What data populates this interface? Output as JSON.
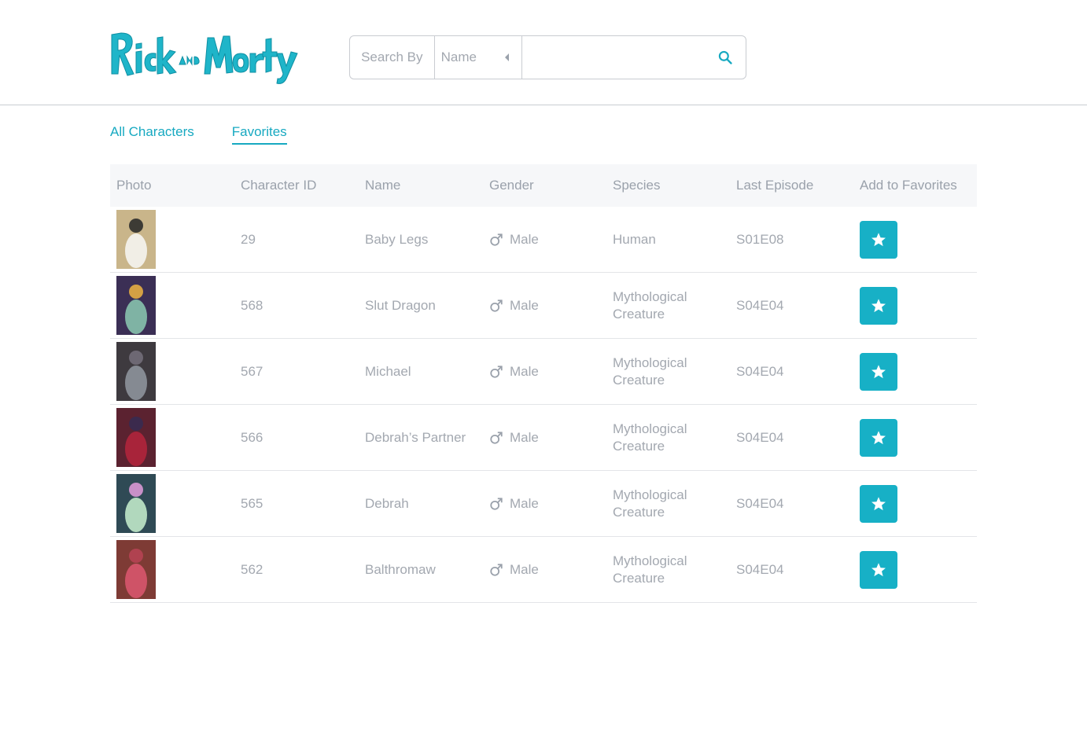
{
  "header": {
    "logo_text": "Rick and Morty",
    "search": {
      "by_label": "Search By",
      "select_value": "Name",
      "input_value": "",
      "input_placeholder": ""
    }
  },
  "tabs": [
    {
      "label": "All Characters",
      "active": false
    },
    {
      "label": "Favorites",
      "active": true
    }
  ],
  "table": {
    "columns": [
      "Photo",
      "Character ID",
      "Name",
      "Gender",
      "Species",
      "Last Episode",
      "Add to Favorites"
    ],
    "rows": [
      {
        "id": "29",
        "name": "Baby Legs",
        "gender": "Male",
        "species": "Human",
        "last_episode": "S01E08"
      },
      {
        "id": "568",
        "name": "Slut Dragon",
        "gender": "Male",
        "species": "Mythological Creature",
        "last_episode": "S04E04"
      },
      {
        "id": "567",
        "name": "Michael",
        "gender": "Male",
        "species": "Mythological Creature",
        "last_episode": "S04E04"
      },
      {
        "id": "566",
        "name": "Debrah’s Partner",
        "gender": "Male",
        "species": "Mythological Creature",
        "last_episode": "S04E04"
      },
      {
        "id": "565",
        "name": "Debrah",
        "gender": "Male",
        "species": "Mythological Creature",
        "last_episode": "S04E04"
      },
      {
        "id": "562",
        "name": "Balthromaw",
        "gender": "Male",
        "species": "Mythological Creature",
        "last_episode": "S04E04"
      }
    ]
  },
  "colors": {
    "accent": "#17b0c6",
    "text_muted": "#a3a8b0",
    "header_bg": "#f6f7f9"
  },
  "icons": {
    "search": "search-icon",
    "gender": "male-symbol-icon",
    "favorite": "star-icon"
  }
}
